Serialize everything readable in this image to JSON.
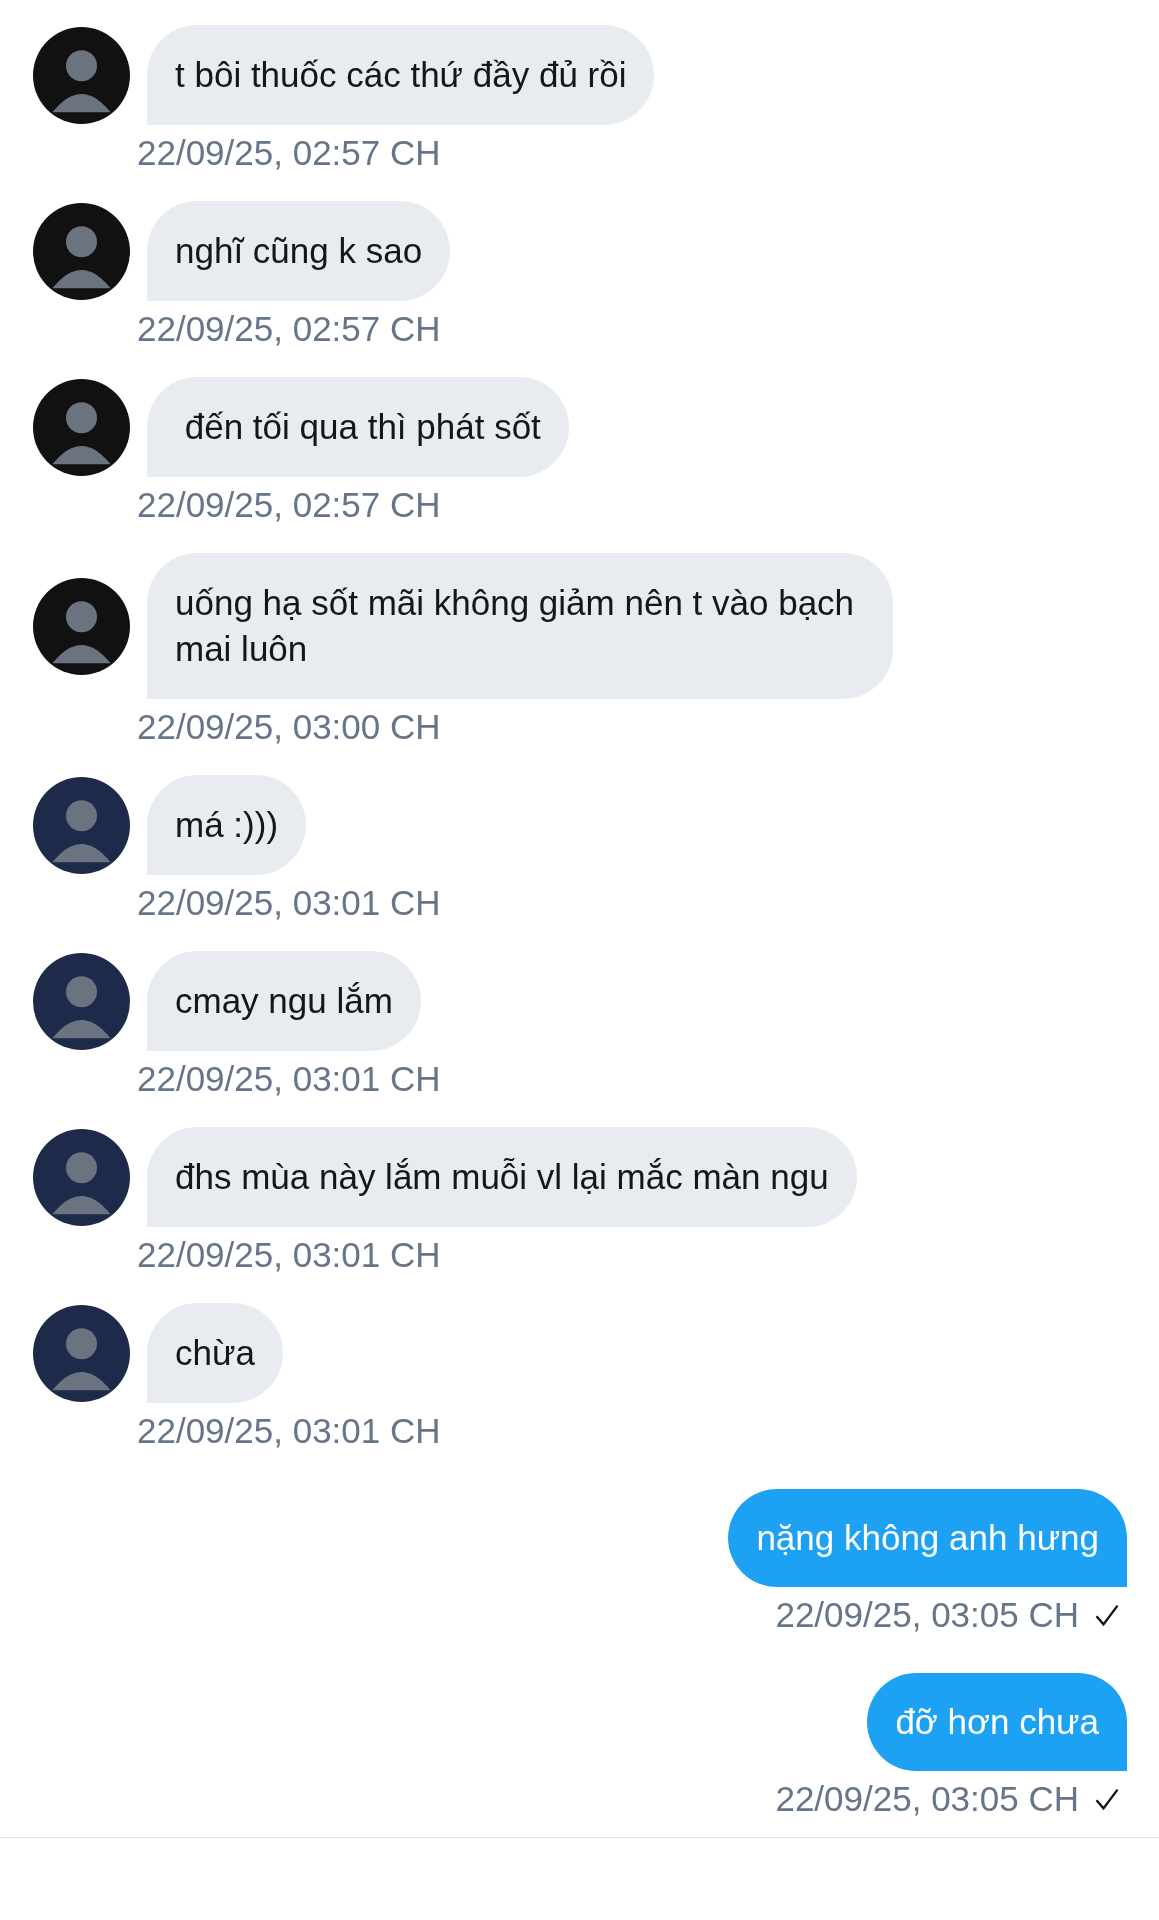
{
  "messages": [
    {
      "kind": "incoming",
      "color": "#111111",
      "text": "t bôi thuốc các thứ đầy đủ rồi",
      "time": "22/09/25, 02:57 CH"
    },
    {
      "kind": "incoming",
      "color": "#111111",
      "text": "nghĩ cũng k sao",
      "time": "22/09/25, 02:57 CH"
    },
    {
      "kind": "incoming",
      "color": "#111111",
      "text": " đến tối qua thì phát sốt",
      "time": "22/09/25, 02:57 CH"
    },
    {
      "kind": "incoming",
      "color": "#111111",
      "text": "uống hạ sốt mãi không giảm nên t vào bạch mai luôn",
      "time": "22/09/25, 03:00 CH"
    },
    {
      "kind": "incoming",
      "color": "#1d2a4a",
      "text": "má :)))",
      "time": "22/09/25, 03:01 CH"
    },
    {
      "kind": "incoming",
      "color": "#1d2a4a",
      "text": "cmay ngu lắm",
      "time": "22/09/25, 03:01 CH"
    },
    {
      "kind": "incoming",
      "color": "#1d2a4a",
      "text": "đhs mùa này lắm muỗi vl lại mắc màn ngu",
      "time": "22/09/25, 03:01 CH"
    },
    {
      "kind": "incoming",
      "color": "#1d2a4a",
      "text": "chừa",
      "time": "22/09/25, 03:01 CH"
    },
    {
      "kind": "outgoing",
      "read": true,
      "text": "nặng không anh hưng",
      "time": "22/09/25, 03:05 CH"
    },
    {
      "kind": "outgoing",
      "read": true,
      "text": "đỡ hơn chưa",
      "time": "22/09/25, 03:05 CH"
    }
  ]
}
